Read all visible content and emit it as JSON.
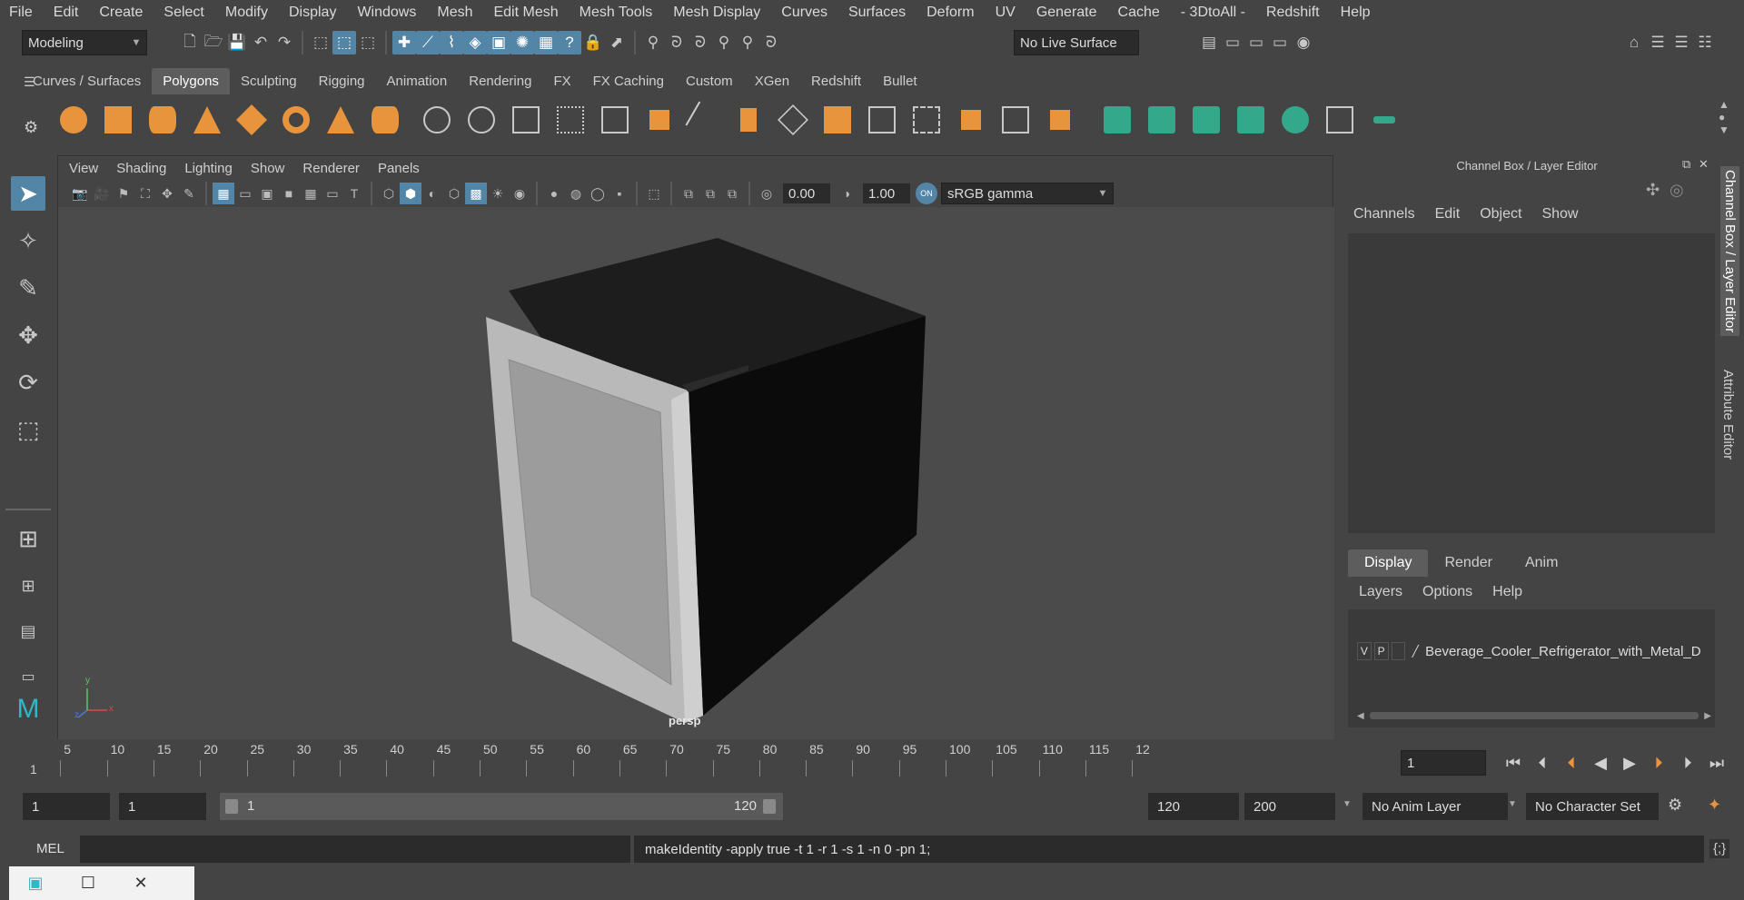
{
  "menubar": [
    "File",
    "Edit",
    "Create",
    "Select",
    "Modify",
    "Display",
    "Windows",
    "Mesh",
    "Edit Mesh",
    "Mesh Tools",
    "Mesh Display",
    "Curves",
    "Surfaces",
    "Deform",
    "UV",
    "Generate",
    "Cache",
    "- 3DtoAll -",
    "Redshift",
    "Help"
  ],
  "status": {
    "mode": "Modeling",
    "live_surface": "No Live Surface"
  },
  "shelf_tabs": [
    "Curves / Surfaces",
    "Polygons",
    "Sculpting",
    "Rigging",
    "Animation",
    "Rendering",
    "FX",
    "FX Caching",
    "Custom",
    "XGen",
    "Redshift",
    "Bullet"
  ],
  "shelf_active": "Polygons",
  "viewport": {
    "menu": [
      "View",
      "Shading",
      "Lighting",
      "Show",
      "Renderer",
      "Panels"
    ],
    "exposure": "0.00",
    "gamma": "1.00",
    "color_space": "sRGB gamma",
    "camera_label": "persp",
    "axis": {
      "x": "x",
      "y": "y",
      "z": "z"
    }
  },
  "channelbox": {
    "title": "Channel Box / Layer Editor",
    "menu": [
      "Channels",
      "Edit",
      "Object",
      "Show"
    ]
  },
  "layer_editor": {
    "tabs": [
      "Display",
      "Render",
      "Anim"
    ],
    "active_tab": "Display",
    "menu": [
      "Layers",
      "Options",
      "Help"
    ],
    "layer": {
      "v": "V",
      "p": "P",
      "name": "Beverage_Cooler_Refrigerator_with_Metal_D"
    }
  },
  "side_tabs": [
    "Channel Box / Layer Editor",
    "Attribute Editor"
  ],
  "timeline": {
    "ticks": [
      "5",
      "10",
      "15",
      "20",
      "25",
      "30",
      "35",
      "40",
      "45",
      "50",
      "55",
      "60",
      "65",
      "70",
      "75",
      "80",
      "85",
      "90",
      "95",
      "100",
      "105",
      "110",
      "115",
      "12"
    ],
    "start_marker": "1",
    "current_frame": "1"
  },
  "range": {
    "start": "1",
    "playback_start": "1",
    "slider_start": "1",
    "slider_end": "120",
    "playback_end": "120",
    "end": "200",
    "anim_layer": "No Anim Layer",
    "character_set": "No Character Set"
  },
  "command": {
    "lang": "MEL",
    "result": "makeIdentity -apply true -t 1 -r 1 -s 1 -n 0 -pn 1;"
  },
  "colors": {
    "accent": "#5285a6",
    "poly_orange": "#e8943c",
    "green": "#33a88a"
  }
}
